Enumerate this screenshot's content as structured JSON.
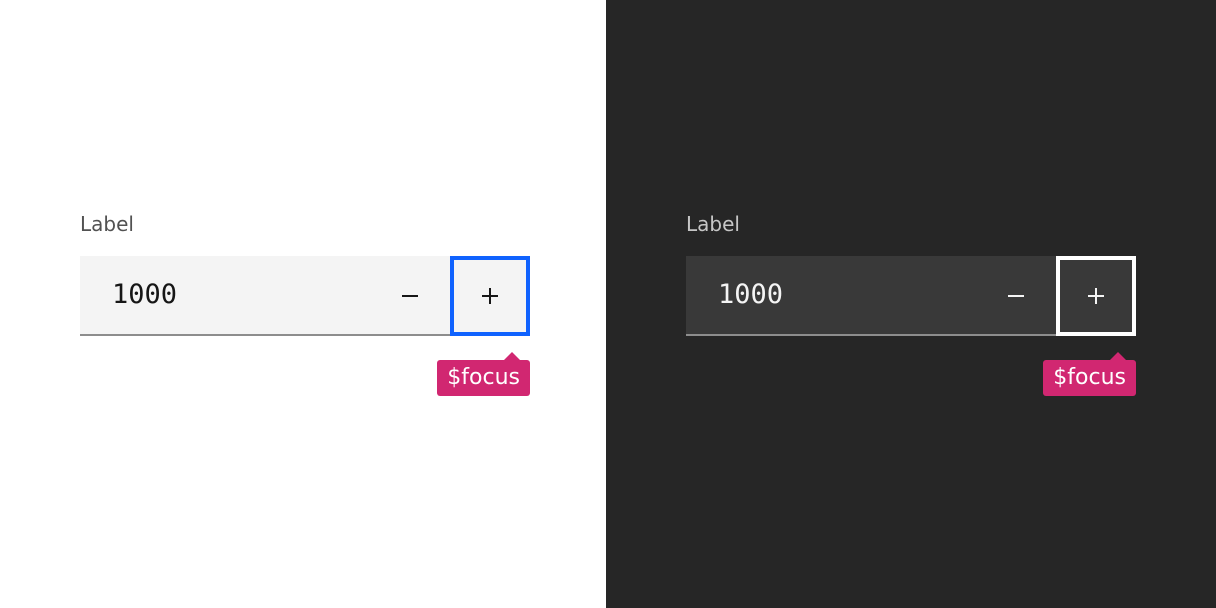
{
  "light": {
    "field": {
      "label": "Label",
      "value": "1000",
      "decrement_icon": "minus-icon",
      "increment_icon": "plus-icon"
    },
    "annotation": "$focus",
    "colors": {
      "background": "#ffffff",
      "focus": "#0f62fe",
      "annotation": "#d12771"
    }
  },
  "dark": {
    "field": {
      "label": "Label",
      "value": "1000",
      "decrement_icon": "minus-icon",
      "increment_icon": "plus-icon"
    },
    "annotation": "$focus",
    "colors": {
      "background": "#262626",
      "focus": "#ffffff",
      "annotation": "#d12771"
    }
  }
}
